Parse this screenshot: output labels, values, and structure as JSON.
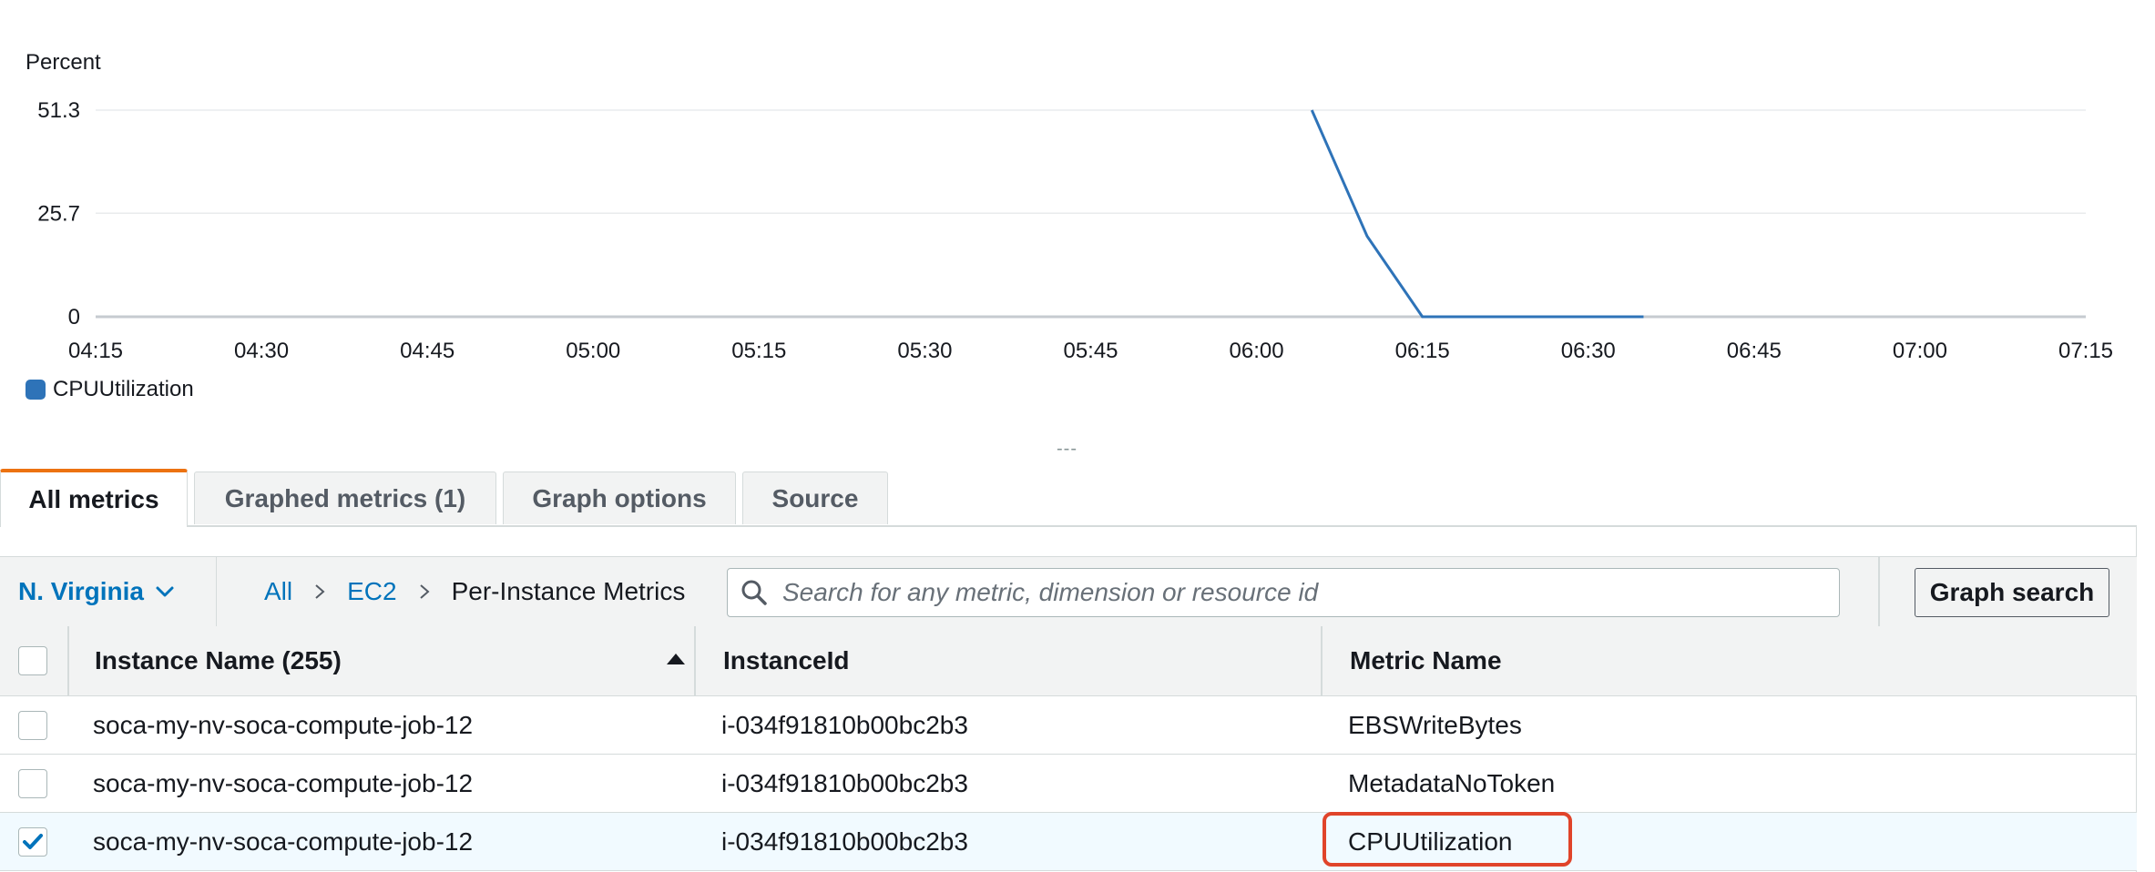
{
  "chart_data": {
    "type": "line",
    "ylabel": "Percent",
    "yticks": [
      "51.3",
      "25.7",
      "0"
    ],
    "ylim": [
      0,
      51.3
    ],
    "xticks": [
      "04:15",
      "04:30",
      "04:45",
      "05:00",
      "05:15",
      "05:30",
      "05:45",
      "06:00",
      "06:15",
      "06:30",
      "06:45",
      "07:00",
      "07:15"
    ],
    "series": [
      {
        "name": "CPUUtilization",
        "color": "#2e73b8",
        "x": [
          "06:05",
          "06:10",
          "06:15",
          "06:20",
          "06:25",
          "06:30",
          "06:35"
        ],
        "values": [
          51.3,
          20,
          0,
          0,
          0,
          0,
          0
        ]
      }
    ],
    "grid": true,
    "legend": "bottom-left"
  },
  "resize_handle": "---",
  "tabs": [
    {
      "label": "All metrics",
      "active": true
    },
    {
      "label": "Graphed metrics (1)",
      "active": false
    },
    {
      "label": "Graph options",
      "active": false
    },
    {
      "label": "Source",
      "active": false
    }
  ],
  "toolbar": {
    "region": "N. Virginia",
    "breadcrumb": {
      "all": "All",
      "namespace": "EC2",
      "current": "Per-Instance Metrics",
      "sep": ">"
    },
    "search_placeholder": "Search for any metric, dimension or resource id",
    "graph_search_label": "Graph search"
  },
  "table": {
    "headers": {
      "instance_name": "Instance Name  (255)",
      "instance_id": "InstanceId",
      "metric_name": "Metric Name"
    },
    "rows": [
      {
        "instance_name": "soca-my-nv-soca-compute-job-12",
        "instance_id": "i-034f91810b00bc2b3",
        "metric_name": "EBSWriteBytes",
        "checked": false
      },
      {
        "instance_name": "soca-my-nv-soca-compute-job-12",
        "instance_id": "i-034f91810b00bc2b3",
        "metric_name": "MetadataNoToken",
        "checked": false
      },
      {
        "instance_name": "soca-my-nv-soca-compute-job-12",
        "instance_id": "i-034f91810b00bc2b3",
        "metric_name": "CPUUtilization",
        "checked": true
      }
    ]
  },
  "colors": {
    "link": "#0073bb",
    "active_tab": "#ec7211",
    "highlight": "#e0442a",
    "series": "#2e73b8"
  }
}
